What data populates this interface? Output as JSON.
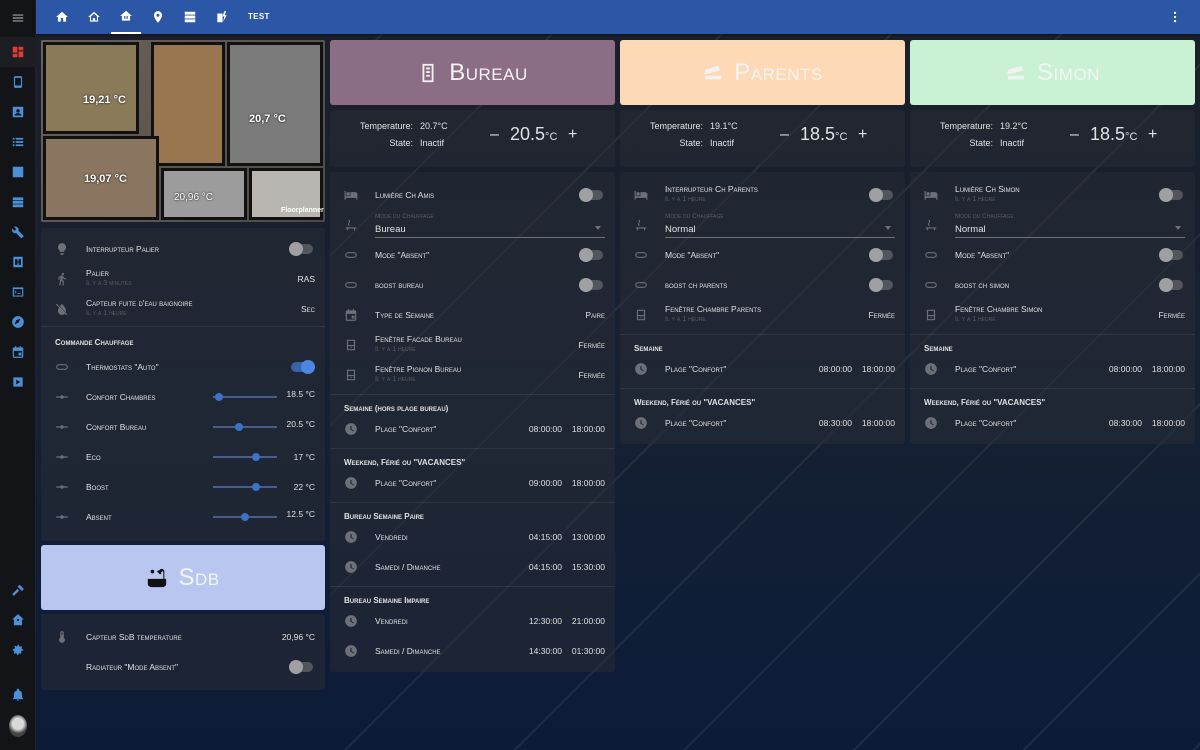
{
  "topbar": {
    "tabs": [
      {
        "icon": "home-icon"
      },
      {
        "icon": "home-outline-icon"
      },
      {
        "icon": "home-heating-icon",
        "active": true
      },
      {
        "icon": "map-marker-icon"
      },
      {
        "icon": "server-icon"
      },
      {
        "icon": "flash-icon"
      }
    ],
    "title": "TEST"
  },
  "sidebar": {
    "items": [
      "menu-icon",
      "dashboard-icon",
      "phone-icon",
      "account-box-icon",
      "list-icon",
      "chart-icon",
      "server-icon",
      "wrench-icon",
      "hacs-icon",
      "terminal-icon",
      "compass-icon",
      "calendar-icon",
      "media-icon",
      "hammer-icon",
      "home-assistant-icon",
      "settings-icon",
      "bell-icon",
      "avatar"
    ]
  },
  "floorplan": {
    "temps": [
      "19,21 °C",
      "20,7 °C",
      "19,07 °C",
      "20,96 °C"
    ],
    "watermark": "Floorplanner"
  },
  "palier": {
    "rows": [
      {
        "label": "Interrupteur Palier",
        "type": "toggle",
        "on": false
      },
      {
        "label": "Palier",
        "sub": "Il y a 3 minutes",
        "value": "RAS"
      },
      {
        "label": "Capteur fuite d'eau baignoire",
        "sub": "Il y a 1 heure",
        "value": "Sec"
      }
    ],
    "section": "Commande Chauffage",
    "thermostats": {
      "label": "Thermostats \"Auto\"",
      "on": true
    },
    "sliders": [
      {
        "label": "Confort Chambres",
        "value": "18.5 °C",
        "level": 0.1
      },
      {
        "label": "Confort Bureau",
        "value": "20.5 °C",
        "level": 0.4
      },
      {
        "label": "Eco",
        "value": "17 °C",
        "level": 0.68
      },
      {
        "label": "Boost",
        "value": "22 °C",
        "level": 0.68
      },
      {
        "label": "Absent",
        "value": "12.5 °C",
        "level": 0.5
      }
    ]
  },
  "sdb": {
    "title": "Sdb",
    "rows": [
      {
        "label": "Capteur SdB temperature",
        "value": "20,96 °C"
      },
      {
        "label": "Radiateur \"Mode Absent\"",
        "on": false
      }
    ]
  },
  "rooms": [
    {
      "title": "Bureau",
      "color": "#8c6d86",
      "temp_label": "Temperature:",
      "temp": "20.7°C",
      "state_label": "State:",
      "state": "Inactif",
      "setpoint": "20.5",
      "unit": "°C",
      "light": "Lumière Ch Amis",
      "mode_label": "Mode du Chauffage",
      "mode": "Bureau",
      "absent": "Mode \"Absent\"",
      "boost": "boost bureau",
      "extra": [
        {
          "label": "Type de Semaine",
          "value": "Paire",
          "icon": "calendar-icon"
        },
        {
          "label": "Fenêtre Facade Bureau",
          "sub": "Il y a 1 heure",
          "value": "Fermée",
          "icon": "window-icon"
        },
        {
          "label": "Fenêtre Pignon Bureau",
          "sub": "Il y a 1 heure",
          "value": "Fermée",
          "icon": "window-icon"
        }
      ],
      "schedules": [
        {
          "title": "Semaine (hors plage bureau)",
          "items": [
            {
              "label": "Plage \"Confort\"",
              "start": "08:00:00",
              "end": "18:00:00"
            }
          ]
        },
        {
          "title": "Weekend, Férié ou \"VACANCES\"",
          "items": [
            {
              "label": "Plage \"Confort\"",
              "start": "09:00:00",
              "end": "18:00:00"
            }
          ]
        },
        {
          "title": "Bureau Semaine Paire",
          "items": [
            {
              "label": "Vendredi",
              "start": "04:15:00",
              "end": "13:00:00"
            },
            {
              "label": "Samedi / Dimanche",
              "start": "04:15:00",
              "end": "15:30:00"
            }
          ]
        },
        {
          "title": "Bureau Semaine Impaire",
          "items": [
            {
              "label": "Vendredi",
              "start": "12:30:00",
              "end": "21:00:00"
            },
            {
              "label": "Samedi / Dimanche",
              "start": "14:30:00",
              "end": "01:30:00"
            }
          ]
        }
      ]
    },
    {
      "title": "Parents",
      "color": "#fdd9b5",
      "temp_label": "Temperature:",
      "temp": "19.1°C",
      "state_label": "State:",
      "state": "Inactif",
      "setpoint": "18.5",
      "unit": "°C",
      "light": "Interrupteur Ch Parents",
      "light_sub": "Il y a 1 heure",
      "mode_label": "Mode du Chauffage",
      "mode": "Normal",
      "absent": "Mode \"Absent\"",
      "boost": "boost ch parents",
      "extra": [
        {
          "label": "Fenêtre Chambre Parents",
          "sub": "Il y a 1 heure",
          "value": "Fermée",
          "icon": "window-icon"
        }
      ],
      "schedules": [
        {
          "title": "Semaine",
          "items": [
            {
              "label": "Plage \"Confort\"",
              "start": "08:00:00",
              "end": "18:00:00"
            }
          ]
        },
        {
          "title": "Weekend, Férié ou \"VACANCES\"",
          "items": [
            {
              "label": "Plage \"Confort\"",
              "start": "08:30:00",
              "end": "18:00:00"
            }
          ]
        }
      ]
    },
    {
      "title": "Simon",
      "color": "#c9f1d3",
      "temp_label": "Temperature:",
      "temp": "19.2°C",
      "state_label": "State:",
      "state": "Inactif",
      "setpoint": "18.5",
      "unit": "°C",
      "light": "Lumière Ch Simon",
      "light_sub": "Il y a 1 heure",
      "mode_label": "Mode du Chauffage",
      "mode": "Normal",
      "absent": "Mode \"Absent\"",
      "boost": "boost ch simon",
      "extra": [
        {
          "label": "Fenêtre Chambre Simon",
          "sub": "Il y a 1 heure",
          "value": "Fermée",
          "icon": "window-icon"
        }
      ],
      "schedules": [
        {
          "title": "Semaine",
          "items": [
            {
              "label": "Plage \"Confort\"",
              "start": "08:00:00",
              "end": "18:00:00"
            }
          ]
        },
        {
          "title": "Weekend, Férié ou \"VACANCES\"",
          "items": [
            {
              "label": "Plage \"Confort\"",
              "start": "08:30:00",
              "end": "18:00:00"
            }
          ]
        }
      ]
    }
  ]
}
